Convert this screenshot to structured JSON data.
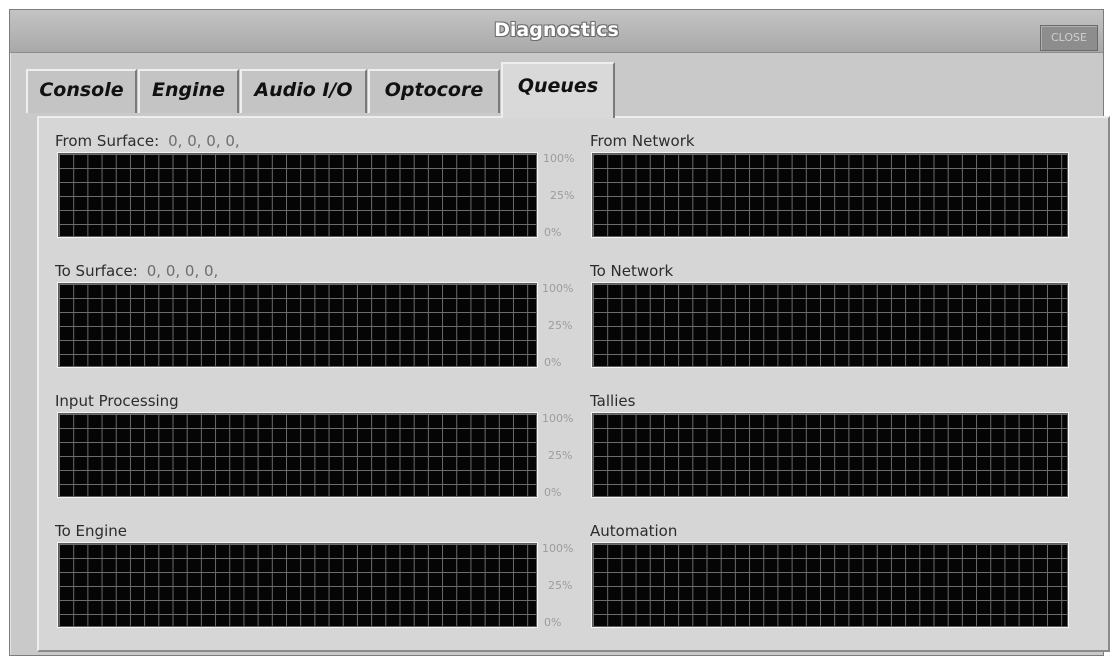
{
  "window": {
    "title": "Diagnostics",
    "close_label": "CLOSE"
  },
  "tabs": [
    {
      "label": "Console",
      "active": false
    },
    {
      "label": "Engine",
      "active": false
    },
    {
      "label": "Audio I/O",
      "active": false
    },
    {
      "label": "Optocore",
      "active": false
    },
    {
      "label": "Queues",
      "active": true
    }
  ],
  "graphs": {
    "from_surface": {
      "label": "From Surface:",
      "values": "0, 0, 0, 0,"
    },
    "to_surface": {
      "label": "To Surface:",
      "values": "0, 0, 0, 0,"
    },
    "input_processing": {
      "label": "Input Processing"
    },
    "to_engine": {
      "label": "To Engine"
    },
    "from_network": {
      "label": "From Network"
    },
    "to_network": {
      "label": "To Network"
    },
    "tallies": {
      "label": "Tallies"
    },
    "automation": {
      "label": "Automation"
    }
  },
  "scale": {
    "top": "100%",
    "mid": "25%",
    "bottom": "0%"
  }
}
